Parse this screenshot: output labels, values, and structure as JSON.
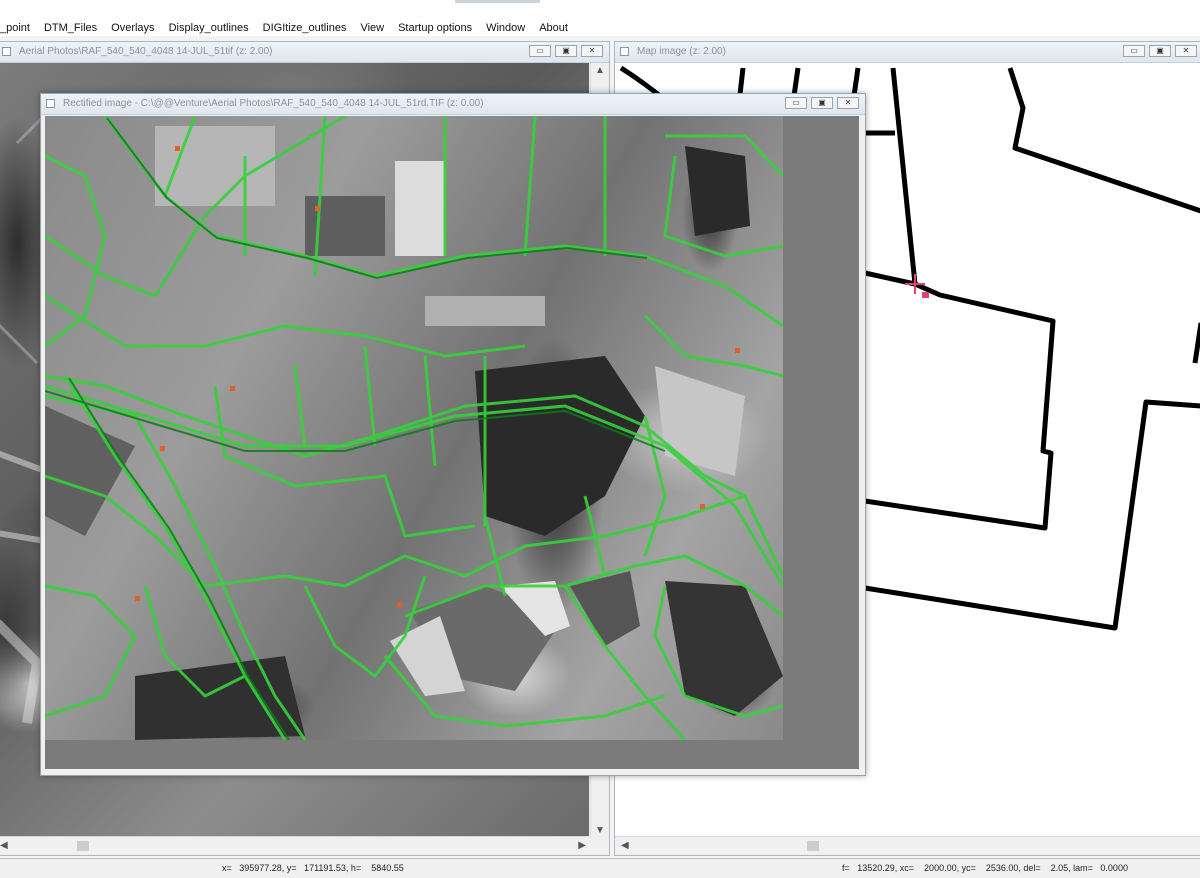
{
  "menu": {
    "items": [
      {
        "label": "_point"
      },
      {
        "label": "DTM_Files"
      },
      {
        "label": "Overlays"
      },
      {
        "label": "Display_outlines"
      },
      {
        "label": "DIGItize_outlines"
      },
      {
        "label": "View"
      },
      {
        "label": "Startup options"
      },
      {
        "label": "Window"
      },
      {
        "label": "About"
      }
    ]
  },
  "windows": {
    "aerial": {
      "title": "Aerial Photos\\RAF_540_540_4048 14-JUL_51tif  (z: 2.00)",
      "buttons": {
        "minimize": "▭",
        "maximize": "▣",
        "close": "✕"
      }
    },
    "map": {
      "title": "Map image   (z: 2.00)",
      "buttons": {
        "minimize": "▭",
        "maximize": "▣",
        "close": "✕"
      }
    },
    "rectified": {
      "title": "Rectified image - C:\\@@Venture\\Aerial Photos\\RAF_540_540_4048 14-JUL_51rd.TIF  (z: 0.00)",
      "buttons": {
        "minimize": "▭",
        "maximize": "▣",
        "close": "✕"
      }
    }
  },
  "scroll_arrows": {
    "up": "▲",
    "down": "▼",
    "left": "◀",
    "right": "▶"
  },
  "status": {
    "left": "x=   395977.28, y=   171191.53, h=    5840.55",
    "right": "f=   13520.29, xc=    2000.00, yc=    2536.00, del=    2.05, lam=   0.0000"
  },
  "colors": {
    "overlay_green": "#36d13a",
    "overlay_dark": "#0e7a1a",
    "map_lines": "#000000",
    "control_point": "#e0407a"
  },
  "icons": {
    "system": "window-system-icon",
    "control_point": "plus-marker-icon"
  }
}
